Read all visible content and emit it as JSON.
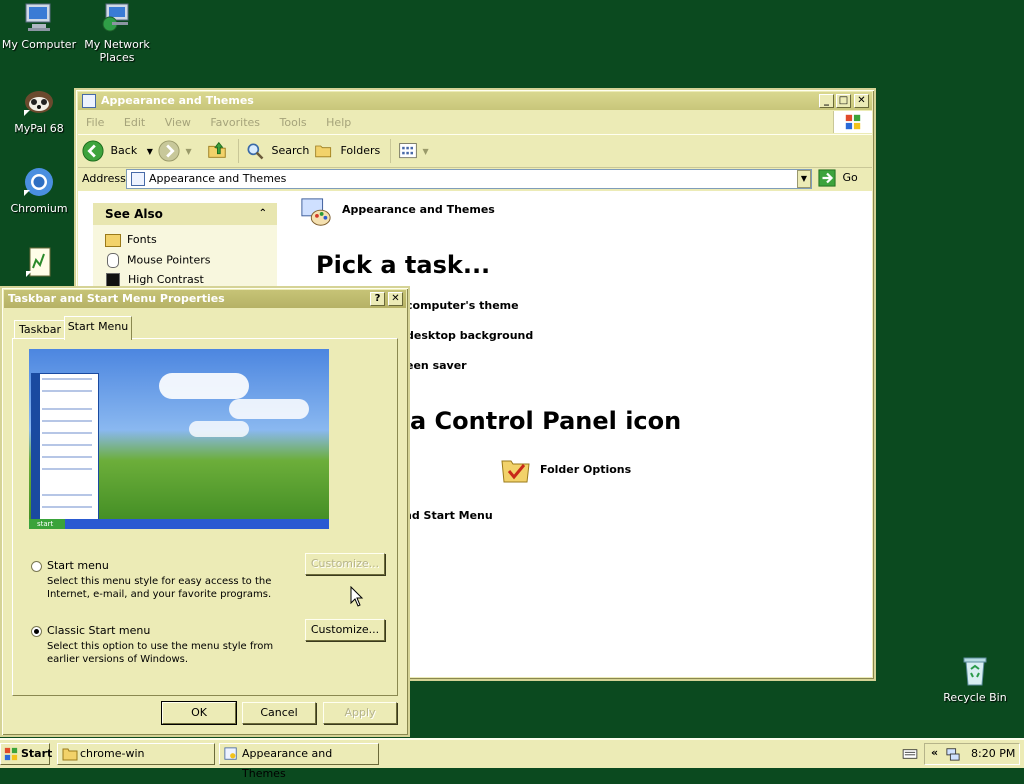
{
  "desktop": {
    "icons": [
      {
        "label": "My Computer"
      },
      {
        "label": "My Network Places"
      },
      {
        "label": "MyPal 68"
      },
      {
        "label": "Chromium"
      },
      {
        "label": ""
      },
      {
        "label": "Recycle Bin"
      }
    ]
  },
  "explorer": {
    "title": "Appearance and Themes",
    "menu": [
      "File",
      "Edit",
      "View",
      "Favorites",
      "Tools",
      "Help"
    ],
    "toolbar": {
      "back": "Back",
      "search": "Search",
      "folders": "Folders"
    },
    "address_label": "Address",
    "address_value": "Appearance and Themes",
    "go": "Go",
    "see_also": {
      "title": "See Also",
      "items": [
        "Fonts",
        "Mouse Pointers",
        "High Contrast"
      ]
    },
    "header_title": "Appearance and Themes",
    "pick_task": "Pick a task...",
    "tasks": [
      "computer's theme",
      "desktop background",
      "een saver"
    ],
    "pick_icon": "a Control Panel icon",
    "icons": [
      "Folder Options",
      "nd Start Menu"
    ]
  },
  "dialog": {
    "title": "Taskbar and Start Menu Properties",
    "help": "?",
    "close": "✕",
    "tabs": [
      "Taskbar",
      "Start Menu"
    ],
    "start_menu": {
      "label": "Start menu",
      "desc": "Select this menu style for easy access to the Internet, e-mail, and your favorite programs.",
      "customize": "Customize..."
    },
    "classic_menu": {
      "label": "Classic Start menu",
      "desc": "Select this option to use the menu style from earlier versions of Windows.",
      "customize": "Customize..."
    },
    "ok": "OK",
    "cancel": "Cancel",
    "apply": "Apply",
    "preview_start": "start"
  },
  "taskbar": {
    "start": "Start",
    "buttons": [
      "chrome-win",
      "Appearance and Themes"
    ],
    "clock": "8:20 PM",
    "tray_chevron": "«"
  }
}
